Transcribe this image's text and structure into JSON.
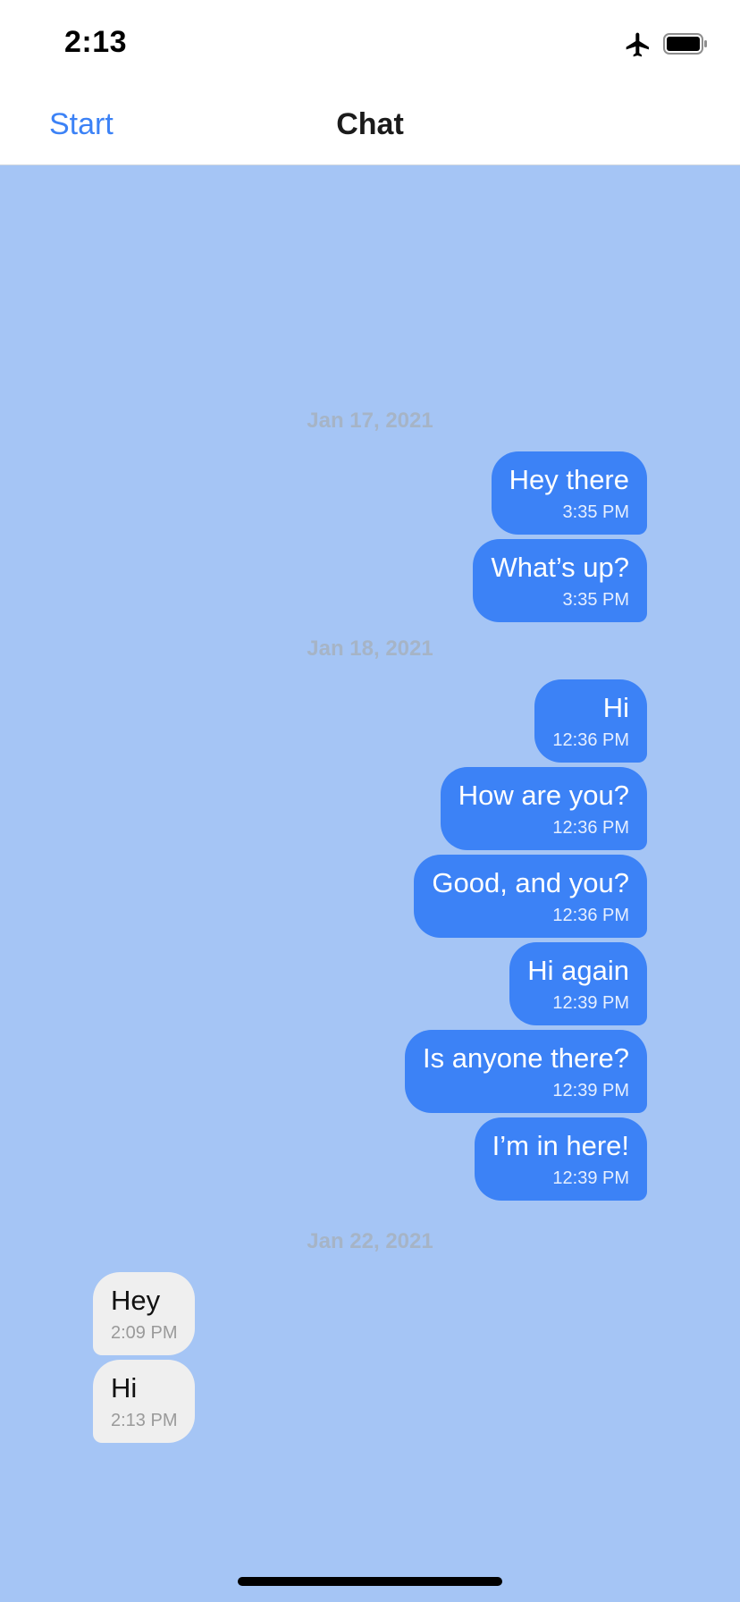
{
  "status_bar": {
    "time": "2:13",
    "icons": [
      "airplane-icon",
      "battery-icon"
    ]
  },
  "nav": {
    "back_label": "Start",
    "title": "Chat"
  },
  "colors": {
    "background": "#a5c5f5",
    "outgoing_bubble": "#3c82f6",
    "incoming_bubble": "#efefef",
    "accent": "#3c82f6"
  },
  "chat": {
    "dates": [
      "Jan 17, 2021",
      "Jan 18, 2021",
      "Jan 22, 2021"
    ],
    "messages": [
      {
        "text": "Hey there",
        "time": "3:35 PM",
        "direction": "out"
      },
      {
        "text": "What’s up?",
        "time": "3:35 PM",
        "direction": "out"
      },
      {
        "text": "Hi",
        "time": "12:36 PM",
        "direction": "out"
      },
      {
        "text": "How are you?",
        "time": "12:36 PM",
        "direction": "out"
      },
      {
        "text": "Good, and you?",
        "time": "12:36 PM",
        "direction": "out"
      },
      {
        "text": "Hi again",
        "time": "12:39 PM",
        "direction": "out"
      },
      {
        "text": "Is anyone there?",
        "time": "12:39 PM",
        "direction": "out"
      },
      {
        "text": "I’m in here!",
        "time": "12:39 PM",
        "direction": "out"
      },
      {
        "text": "Hey",
        "time": "2:09 PM",
        "direction": "in"
      },
      {
        "text": "Hi",
        "time": "2:13 PM",
        "direction": "in"
      }
    ]
  }
}
